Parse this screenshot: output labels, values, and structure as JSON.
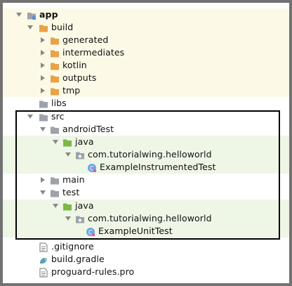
{
  "tree": {
    "app": "app",
    "build": "build",
    "generated": "generated",
    "intermediates": "intermediates",
    "kotlin": "kotlin",
    "outputs": "outputs",
    "tmp": "tmp",
    "libs": "libs",
    "src": "src",
    "androidTest": "androidTest",
    "java_androidTest": "java",
    "pkg_androidTest": "com.tutorialwing.helloworld",
    "instrumented_test": "ExampleInstrumentedTest",
    "main": "main",
    "test": "test",
    "java_test": "java",
    "pkg_test": "com.tutorialwing.helloworld",
    "unit_test": "ExampleUnitTest",
    "gitignore": ".gitignore",
    "build_gradle": "build.gradle",
    "proguard": "proguard-rules.pro"
  },
  "colors": {
    "folder_orange": "#e8a24a",
    "folder_grey": "#9ea3a9",
    "folder_green": "#7bb84a",
    "row_yellow": "#fcfae6",
    "row_green": "#eef6e6",
    "highlight_border": "#000000"
  }
}
